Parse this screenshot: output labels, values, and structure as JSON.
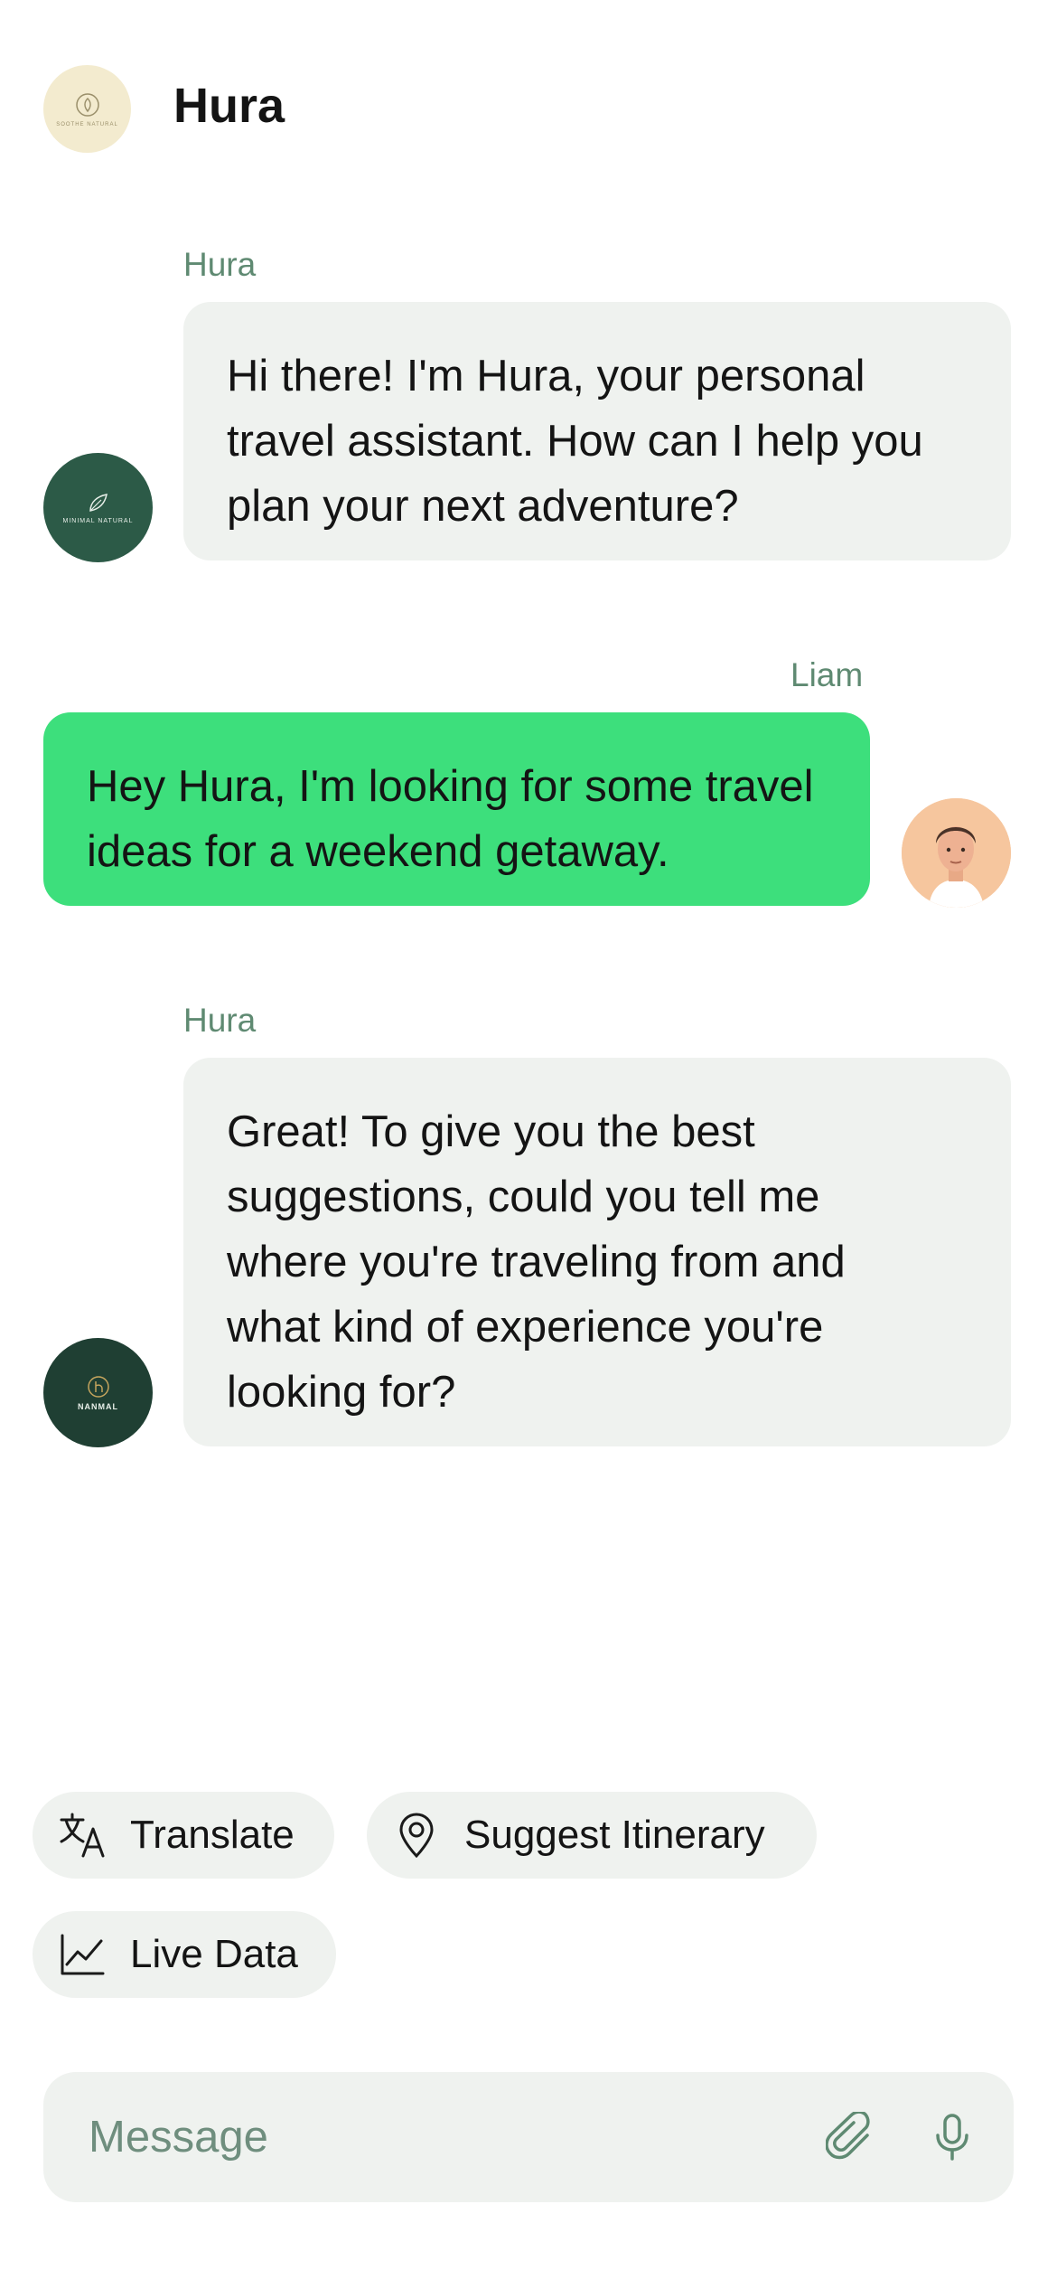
{
  "header": {
    "title": "Hura",
    "avatar_text": "SOOTHE NATURAL"
  },
  "messages": [
    {
      "sender": "Hura",
      "text": "Hi there! I'm Hura, your personal\ntravel assistant. How can I help you\n plan your next adventure?",
      "avatar_text": "MINIMAL NATURAL"
    },
    {
      "sender": "Liam",
      "text": "Hey Hura, I'm looking for some travel\n ideas for a weekend getaway."
    },
    {
      "sender": "Hura",
      "text": "Great! To give you the best\nsuggestions, could you tell me\nwhere you're traveling from and\nwhat kind of experience you're\n looking for?",
      "avatar_text": "NANMAL"
    }
  ],
  "chips": [
    {
      "label": "Translate",
      "icon": "translate-icon"
    },
    {
      "label": "Suggest Itinerary",
      "icon": "map-pin-icon"
    },
    {
      "label": "Live Data",
      "icon": "line-chart-icon"
    }
  ],
  "composer": {
    "placeholder": "Message",
    "attach_icon": "paperclip-icon",
    "mic_icon": "microphone-icon"
  },
  "colors": {
    "user_bubble": "#3ddf7c",
    "bot_bubble": "#eff2ef",
    "sender_label": "#5f8a72"
  }
}
